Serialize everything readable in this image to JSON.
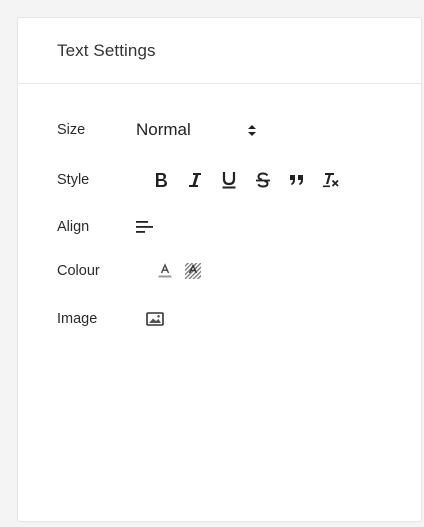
{
  "panel": {
    "title": "Text Settings"
  },
  "rows": {
    "size": {
      "label": "Size",
      "value": "Normal"
    },
    "style": {
      "label": "Style",
      "buttons": [
        "bold-icon",
        "italic-icon",
        "underline-icon",
        "strikethrough-icon",
        "blockquote-icon",
        "clear-format-icon"
      ]
    },
    "align": {
      "label": "Align",
      "icon": "align-left-icon"
    },
    "colour": {
      "label": "Colour",
      "icons": [
        "font-color-icon",
        "background-color-icon"
      ]
    },
    "image": {
      "label": "Image",
      "icon": "image-icon"
    }
  },
  "colors": {
    "page_bg": "#f4f4f5",
    "panel_bg": "#ffffff",
    "border": "#e4e4e7",
    "text": "#222222"
  }
}
